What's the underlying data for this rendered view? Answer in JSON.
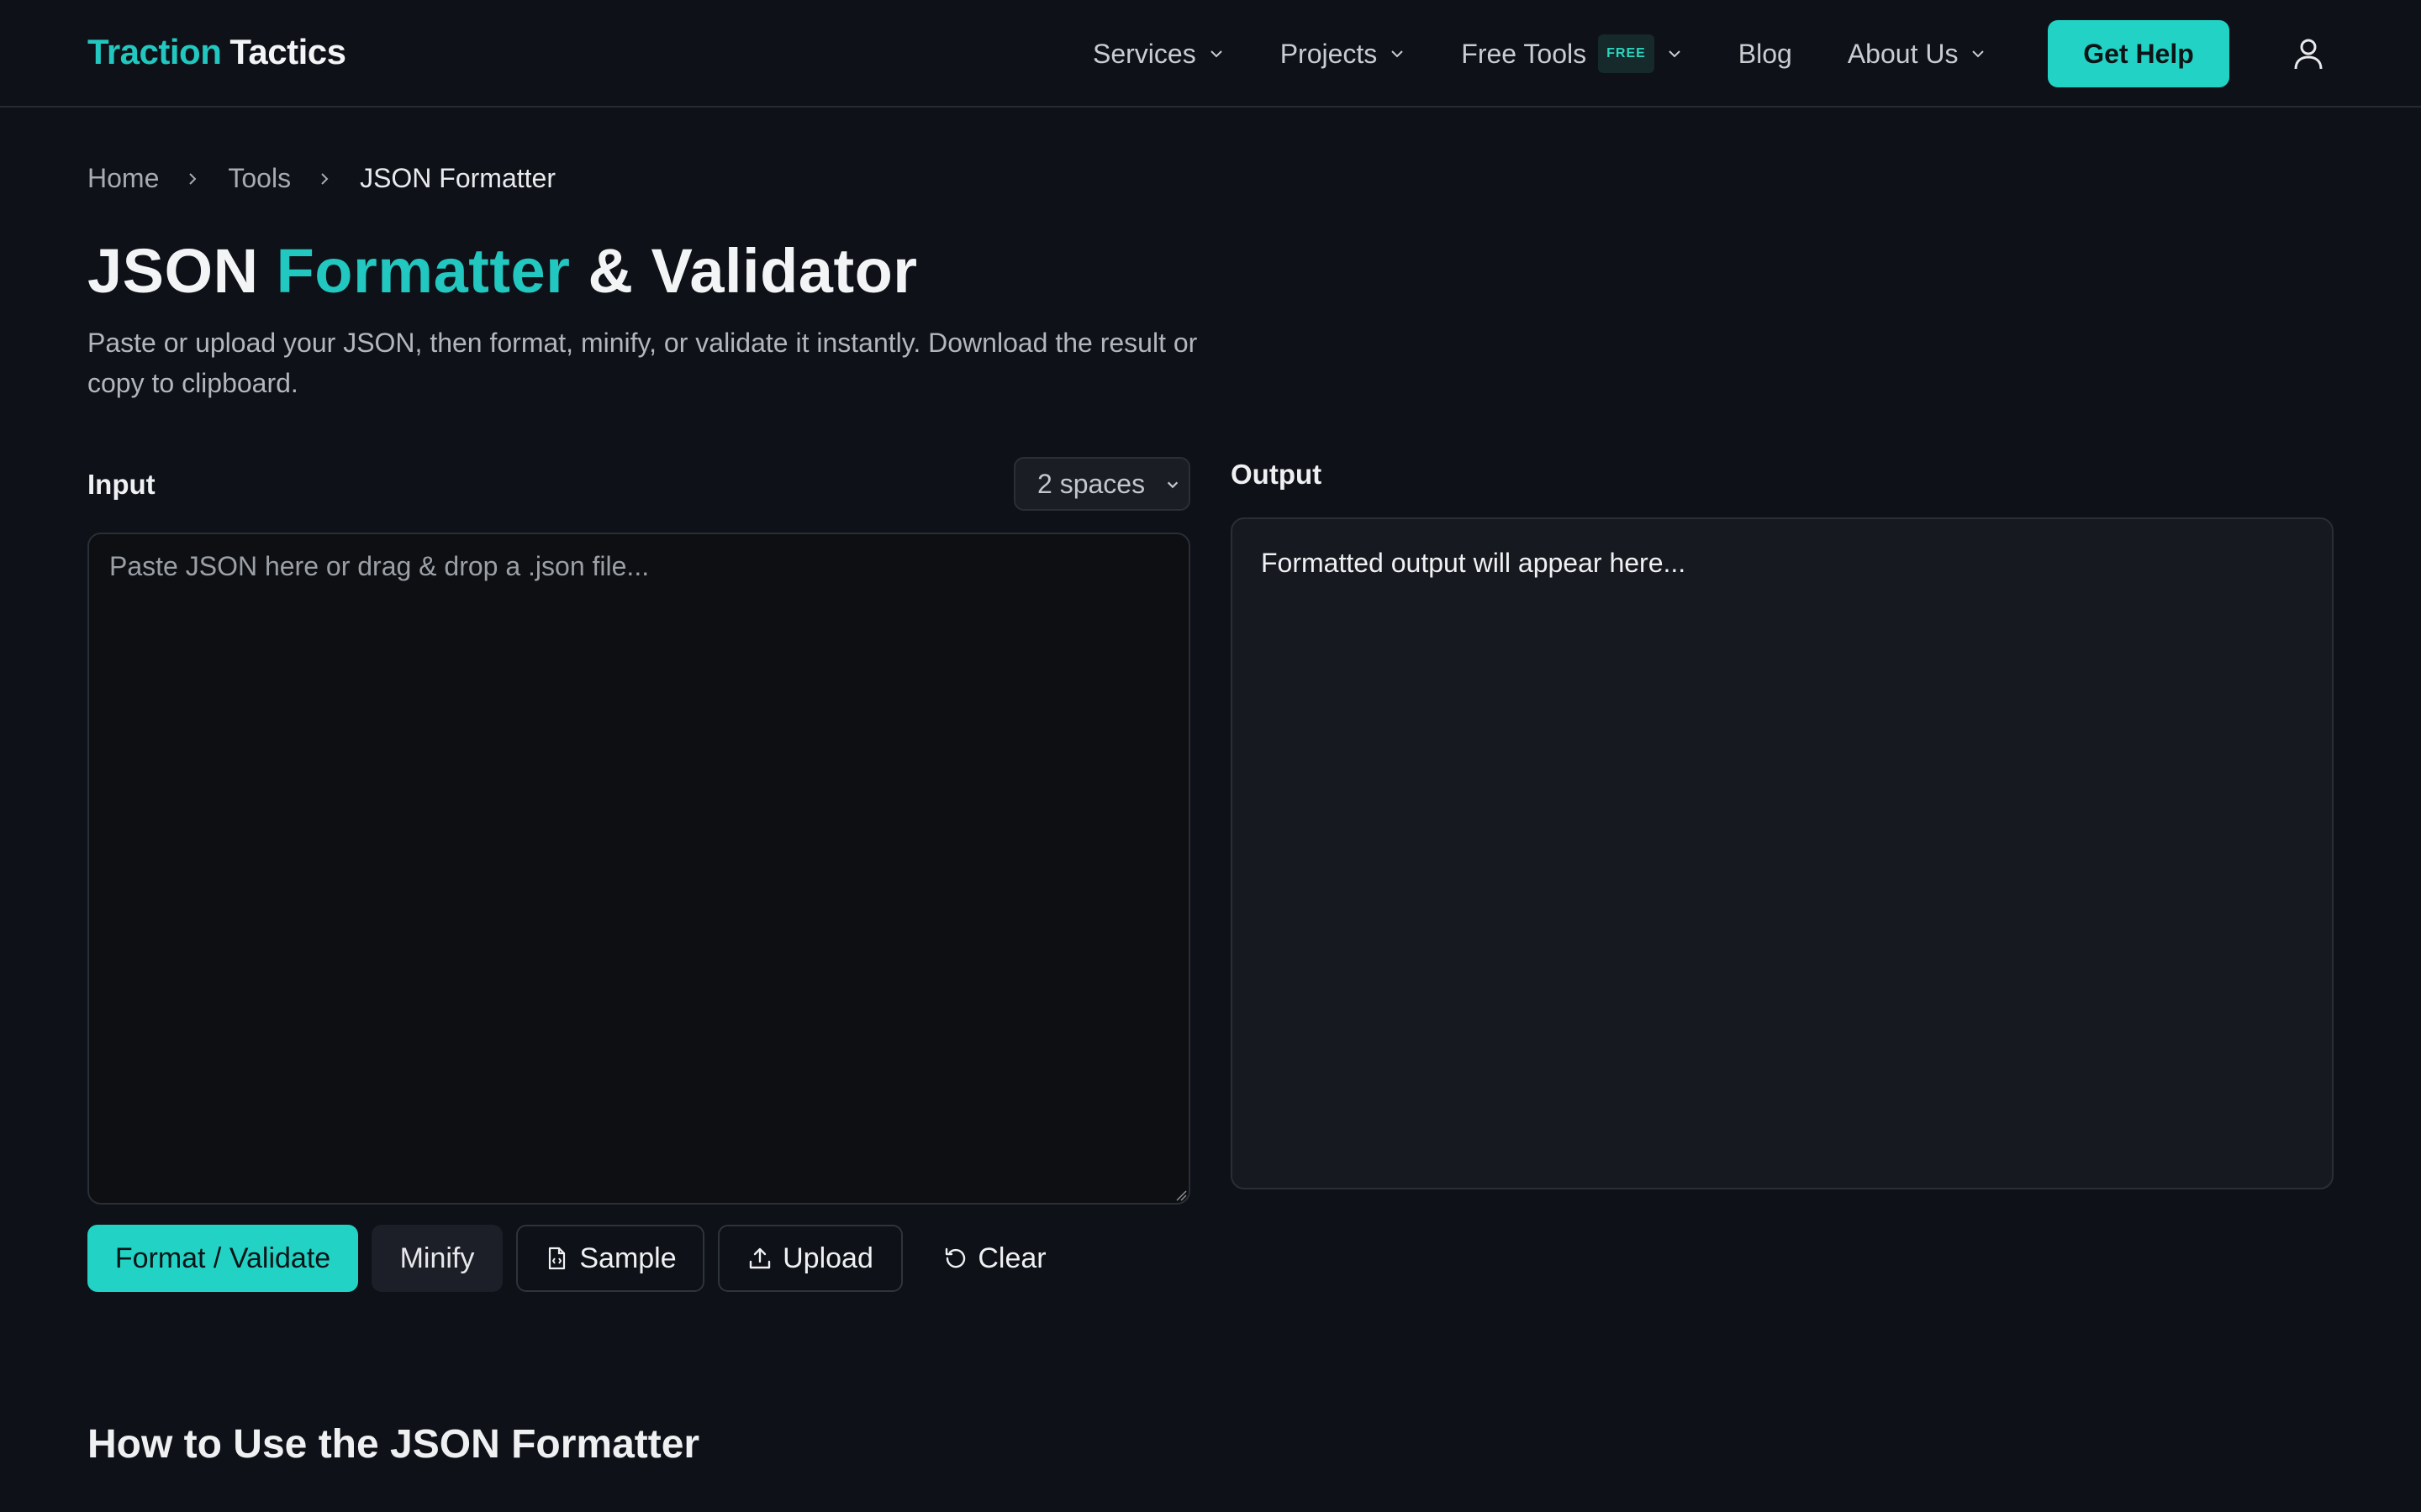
{
  "header": {
    "logo_primary": "Traction",
    "logo_secondary": "Tactics",
    "nav": {
      "services": "Services",
      "projects": "Projects",
      "free_tools": "Free Tools",
      "free_badge": "FREE",
      "blog": "Blog",
      "about": "About Us"
    },
    "cta": "Get Help"
  },
  "breadcrumb": {
    "home": "Home",
    "tools": "Tools",
    "current": "JSON Formatter"
  },
  "title": {
    "part1": "JSON",
    "accent": "Formatter",
    "part2": "& Validator"
  },
  "subtitle": "Paste or upload your JSON, then format, minify, or validate it instantly. Download the result or copy to clipboard.",
  "input": {
    "label": "Input",
    "indent_value": "2 spaces",
    "placeholder": "Paste JSON here or drag & drop a .json file...",
    "value": ""
  },
  "output": {
    "label": "Output",
    "placeholder_text": "Formatted output will appear here..."
  },
  "actions": {
    "format": "Format / Validate",
    "minify": "Minify",
    "sample": "Sample",
    "upload": "Upload",
    "clear": "Clear"
  },
  "section_heading": "How to Use the JSON Formatter",
  "colors": {
    "background": "#0e1117",
    "accent": "#22d3c5",
    "accent_text": "#22c7c0",
    "panel": "#161920"
  },
  "icons": {
    "nav_dropdown": "chevron-down-icon",
    "breadcrumb_separator": "chevron-right-icon",
    "user": "user-icon",
    "sample": "file-code-icon",
    "upload": "upload-icon",
    "clear": "rotate-ccw-icon"
  }
}
